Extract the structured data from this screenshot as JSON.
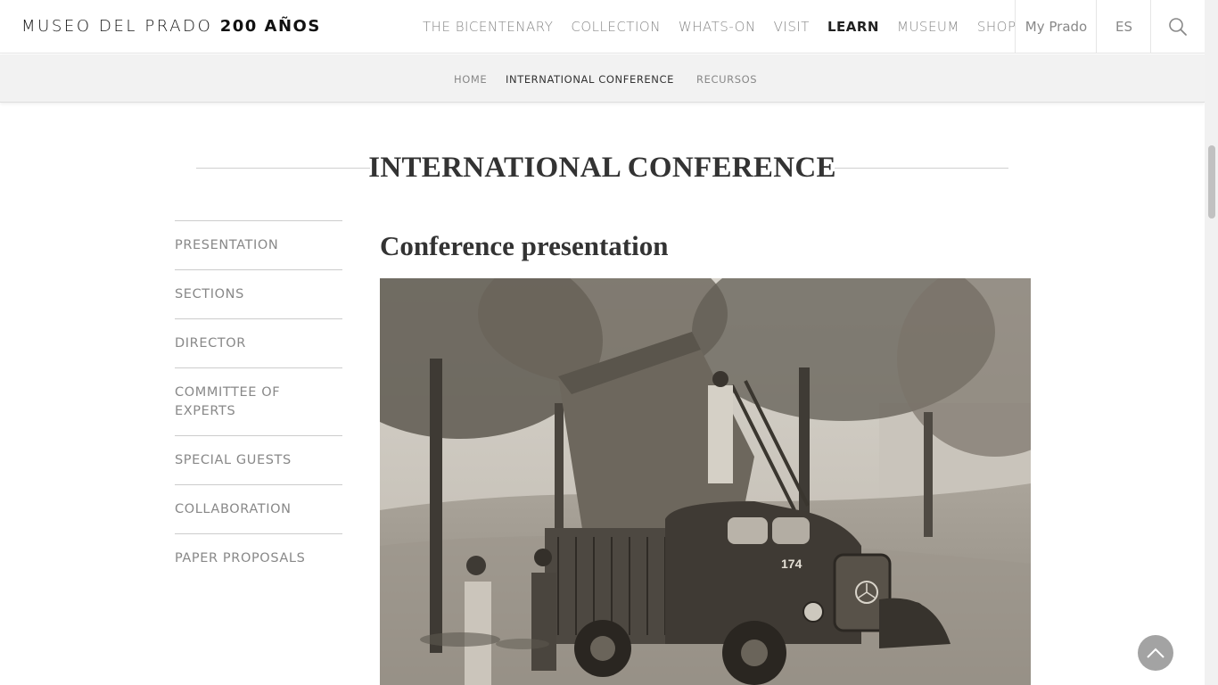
{
  "header": {
    "logo_text": "MUSEO DEL PRADO",
    "logo_bold": "200 AÑOS",
    "nav": [
      {
        "label": "THE BICENTENARY"
      },
      {
        "label": "COLLECTION"
      },
      {
        "label": "WHATS-ON"
      },
      {
        "label": "VISIT"
      },
      {
        "label": "LEARN",
        "active": true
      },
      {
        "label": "MUSEUM"
      },
      {
        "label": "SHOP"
      }
    ],
    "my_prado": "My Prado",
    "language": "ES",
    "search_icon": "search-icon"
  },
  "subnav": {
    "items": [
      {
        "label": "HOME"
      },
      {
        "label": "INTERNATIONAL CONFERENCE",
        "active": true
      },
      {
        "label": "RECURSOS"
      }
    ]
  },
  "page": {
    "title": "INTERNATIONAL CONFERENCE",
    "heading": "Conference presentation"
  },
  "side_menu": {
    "items": [
      {
        "label": "PRESENTATION"
      },
      {
        "label": "SECTIONS"
      },
      {
        "label": "DIRECTOR"
      },
      {
        "label": "COMMITTEE OF EXPERTS"
      },
      {
        "label": "SPECIAL GUESTS"
      },
      {
        "label": "COLLABORATION"
      },
      {
        "label": "PAPER PROPOSALS"
      }
    ]
  },
  "photo": {
    "truck_number": "174"
  },
  "colors": {
    "text_dark": "#333333",
    "text_muted": "#888888",
    "subnav_bg": "#f2f2f2",
    "back_top_bg": "#a3a3a3"
  },
  "icons": {
    "back_to_top": "chevron-up-icon"
  }
}
